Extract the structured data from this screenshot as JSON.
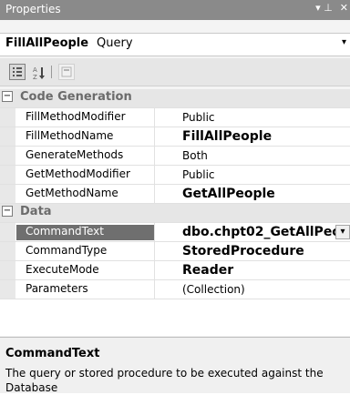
{
  "titlebar": {
    "title": "Properties",
    "pin_glyph": "▾ ⊥",
    "close_glyph": "✕"
  },
  "object_selector": {
    "name": "FillAllPeople",
    "type": "Query",
    "dropdown_icon": "chevron-down-icon"
  },
  "toolbar": {
    "buttons": [
      {
        "name": "categorized-icon",
        "active": true
      },
      {
        "name": "alphabetical-icon",
        "active": false
      },
      {
        "name": "property-pages-icon",
        "active": false
      }
    ]
  },
  "grid": {
    "categories": [
      {
        "label": "Code Generation",
        "expanded_glyph": "−",
        "rows": [
          {
            "label": "FillMethodModifier",
            "value": "Public",
            "bold": false
          },
          {
            "label": "FillMethodName",
            "value": "FillAllPeople",
            "bold": true
          },
          {
            "label": "GenerateMethods",
            "value": "Both",
            "bold": false
          },
          {
            "label": "GetMethodModifier",
            "value": "Public",
            "bold": false
          },
          {
            "label": "GetMethodName",
            "value": "GetAllPeople",
            "bold": true
          }
        ]
      },
      {
        "label": "Data",
        "expanded_glyph": "−",
        "rows": [
          {
            "label": "CommandText",
            "value": "dbo.chpt02_GetAllPeo",
            "bold": true,
            "selected": true
          },
          {
            "label": "CommandType",
            "value": "StoredProcedure",
            "bold": true
          },
          {
            "label": "ExecuteMode",
            "value": "Reader",
            "bold": true
          },
          {
            "label": "Parameters",
            "value": "(Collection)",
            "bold": false
          }
        ]
      }
    ]
  },
  "description": {
    "title": "CommandText",
    "text": "The query or stored procedure to be executed against the Database"
  },
  "colors": {
    "titlebar": "#8a8a8a",
    "selected": "#6f6f6f",
    "category_text": "#6b6b6b"
  }
}
